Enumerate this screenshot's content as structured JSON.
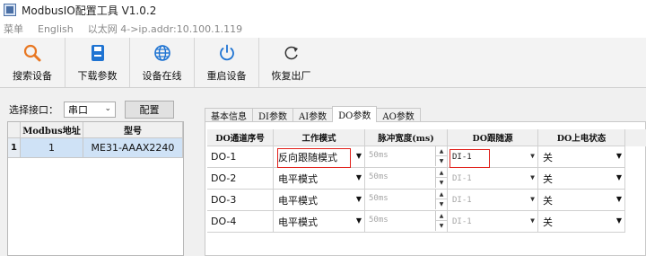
{
  "window": {
    "title": "ModbusIO配置工具 V1.0.2"
  },
  "menu": {
    "items": [
      "菜单",
      "English",
      "以太网 4->ip.addr:10.100.1.119"
    ]
  },
  "toolbar": {
    "buttons": [
      {
        "label": "搜索设备",
        "icon": "search-icon"
      },
      {
        "label": "下载参数",
        "icon": "save-icon"
      },
      {
        "label": "设备在线",
        "icon": "globe-icon"
      },
      {
        "label": "重启设备",
        "icon": "power-icon"
      },
      {
        "label": "恢复出厂",
        "icon": "refresh-icon"
      }
    ]
  },
  "left": {
    "port_label": "选择接口：",
    "port_value": "串口",
    "config_label": "配置",
    "table": {
      "headers": [
        "Modbus地址",
        "型号"
      ],
      "rows": [
        {
          "index": "1",
          "address": "1",
          "model": "ME31-AAAX2240"
        }
      ]
    }
  },
  "tabs": [
    "基本信息",
    "DI参数",
    "AI参数",
    "DO参数",
    "AO参数"
  ],
  "active_tab": "DO参数",
  "do_table": {
    "headers": [
      "DO通道序号",
      "工作模式",
      "脉冲宽度(ms)",
      "DO跟随源",
      "DO上电状态"
    ],
    "rows": [
      {
        "channel": "DO-1",
        "mode": "反向跟随模式",
        "pulse": "50ms",
        "source": "DI-1",
        "power_on": "关"
      },
      {
        "channel": "DO-2",
        "mode": "电平模式",
        "pulse": "50ms",
        "source": "DI-1",
        "power_on": "关"
      },
      {
        "channel": "DO-3",
        "mode": "电平模式",
        "pulse": "50ms",
        "source": "DI-1",
        "power_on": "关"
      },
      {
        "channel": "DO-4",
        "mode": "电平模式",
        "pulse": "50ms",
        "source": "DI-1",
        "power_on": "关"
      }
    ]
  },
  "colors": {
    "highlight": "#e0201a",
    "selected_row": "#cfe2f6",
    "accent": "#1e73d2"
  }
}
